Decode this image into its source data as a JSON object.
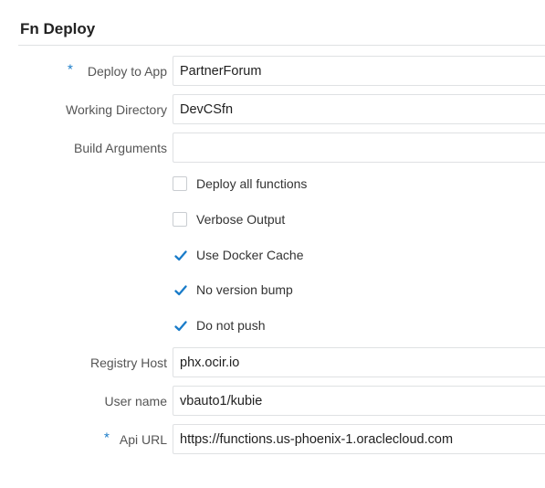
{
  "section": {
    "title": "Fn Deploy"
  },
  "deploy_to_app": {
    "label": "Deploy to App",
    "required_marker": "*",
    "value": "PartnerForum"
  },
  "working_directory": {
    "label": "Working Directory",
    "value": "DevCSfn"
  },
  "build_arguments": {
    "label": "Build Arguments",
    "value": ""
  },
  "options": [
    {
      "label": "Deploy all functions",
      "checked": false
    },
    {
      "label": "Verbose Output",
      "checked": false
    },
    {
      "label": "Use Docker Cache",
      "checked": true
    },
    {
      "label": "No version bump",
      "checked": true
    },
    {
      "label": "Do not push",
      "checked": true
    }
  ],
  "registry_host": {
    "label": "Registry Host",
    "value": "phx.ocir.io"
  },
  "user_name": {
    "label": "User name",
    "value": "vbauto1/kubie"
  },
  "api_url": {
    "label": "Api URL",
    "required_marker": "*",
    "value": "https://functions.us-phoenix-1.oraclecloud.com"
  },
  "colors": {
    "check_accent": "#1a7cc9",
    "required_marker": "#1a7cc9",
    "input_border": "#dfe1e3"
  }
}
